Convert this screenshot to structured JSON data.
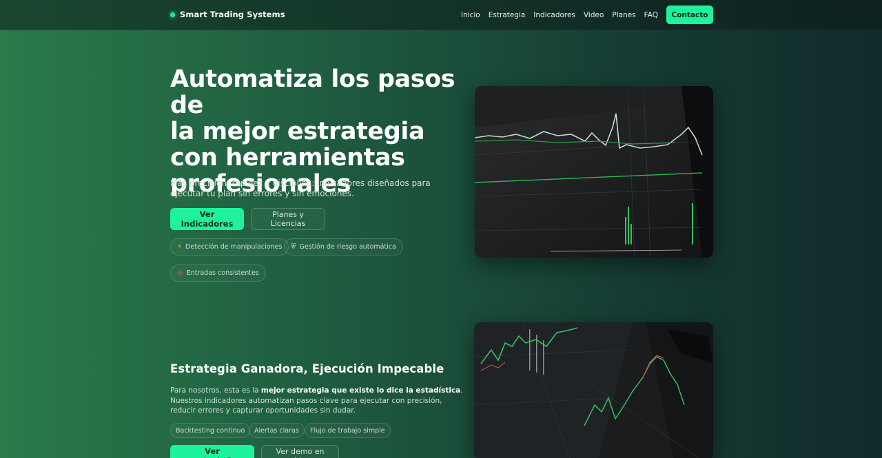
{
  "nav": {
    "brand": "Smart Trading Systems",
    "links": [
      "Inicio",
      "Estrategia",
      "Indicadores",
      "Video",
      "Planes",
      "FAQ"
    ],
    "contact": "Contacto"
  },
  "hero": {
    "title_lines": [
      "Automatiza los pasos de",
      "la mejor estrategia",
      "con herramientas",
      "profesionales"
    ],
    "subtitle": "Más precisión, rapidez y disciplina: indicadores diseñados para ejecutar tu plan sin errores y sin emociones.",
    "primary_button": "Ver Indicadores",
    "secondary_button": "Planes y Licencias",
    "chips": [
      {
        "icon": "lightning-icon",
        "glyph": "⚡",
        "label": "Detección de manipulaciones"
      },
      {
        "icon": "shield-icon",
        "glyph": "⛨",
        "label": "Gestión de riesgo automática"
      },
      {
        "icon": "target-icon",
        "glyph": "◎",
        "label": "Entradas consistentes"
      }
    ]
  },
  "strategy": {
    "title": "Estrategia Ganadora, Ejecución Impecable",
    "body_pre": "Para nosotros, esta es la ",
    "body_bold": "mejor estrategia que existe lo dice la estadística",
    "body_post": ". Nuestros indicadores automatizan pasos clave para ejecutar con precisión, reducir errores y capturar oportunidades sin dudar.",
    "tags": [
      "Backtesting continuo",
      "Alertas claras",
      "Flujo de trabajo simple"
    ],
    "primary_button": "Ver características",
    "secondary_button": "Ver demo en video"
  },
  "colors": {
    "accent": "#1ef29c",
    "bg_left": "#2a7a4a",
    "bg_right": "#102a2a"
  }
}
